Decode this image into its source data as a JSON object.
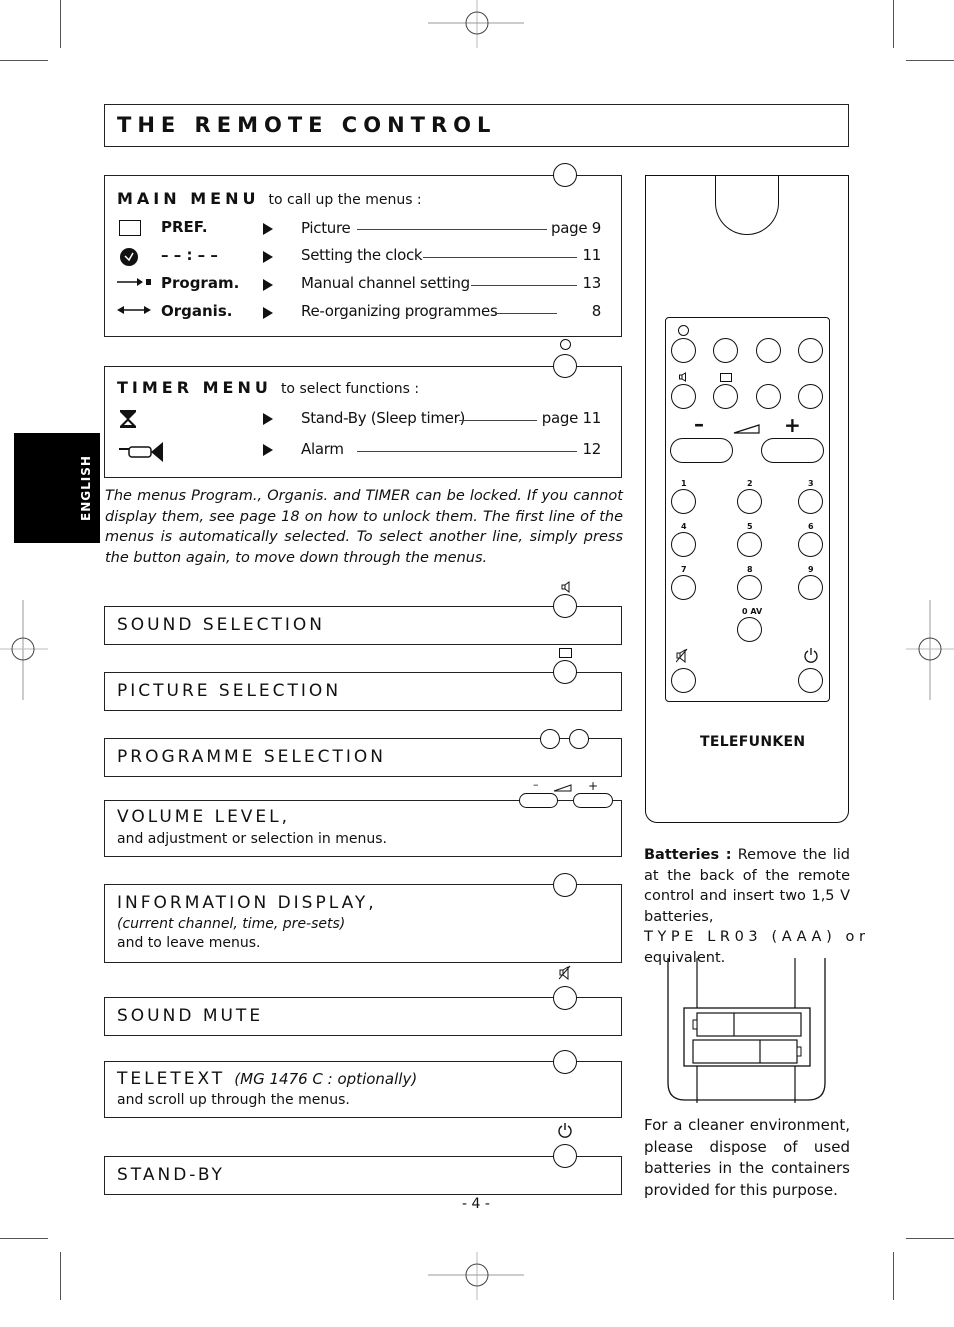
{
  "page": {
    "title": "THE REMOTE CONTROL",
    "side_tab": "ENGLISH",
    "page_number": "- 4 -"
  },
  "main_menu": {
    "title": "MAIN MENU",
    "subtitle": "to call up the menus :",
    "items": [
      {
        "icon": "screen-icon",
        "label": "PREF.",
        "desc": "Picture",
        "page": "page 9"
      },
      {
        "icon": "clock-icon",
        "label": "– – : – –",
        "desc": "Setting the clock",
        "page": "11"
      },
      {
        "icon": "arrow-right-icon",
        "label": "Program.",
        "desc": "Manual channel setting",
        "page": "13"
      },
      {
        "icon": "arrow-both-icon",
        "label": "Organis.",
        "desc": "Re-organizing programmes",
        "page": "8"
      }
    ]
  },
  "timer_menu": {
    "title": "TIMER MENU",
    "subtitle": "to select functions :",
    "items": [
      {
        "icon": "hourglass-icon",
        "desc": "Stand-By (Sleep timer)",
        "page": "page 11"
      },
      {
        "icon": "horn-icon",
        "desc": "Alarm",
        "page": "12"
      }
    ]
  },
  "note": "The menus Program., Organis. and TIMER can be locked. If you cannot display them, see page 18 on how to unlock them. The first line of the menus is automatically selected. To select another line, simply press the button again, to move down through the menus.",
  "sections": [
    {
      "title": "SOUND SELECTION"
    },
    {
      "title": "PICTURE SELECTION"
    },
    {
      "title": "PROGRAMME SELECTION"
    },
    {
      "title": "VOLUME LEVEL,",
      "line2": "and adjustment or selection in menus."
    },
    {
      "title": "INFORMATION DISPLAY,",
      "line2": "(current channel, time, pre-sets)",
      "line3": "and to leave menus."
    },
    {
      "title": "SOUND MUTE"
    },
    {
      "title": "TELETEXT",
      "title_italic": "(MG 1476 C : optionally)",
      "line2": "and scroll up through the menus."
    },
    {
      "title": "STAND-BY"
    }
  ],
  "volume_symbols": {
    "minus": "–",
    "plus": "+"
  },
  "remote": {
    "brand": "TELEFUNKEN",
    "numbers": [
      "1",
      "2",
      "3",
      "4",
      "5",
      "6",
      "7",
      "8",
      "9"
    ],
    "zero": "0 AV",
    "minus": "–",
    "plus": "+"
  },
  "batteries": {
    "heading": "Batteries :",
    "text": "Remove the lid at the back of the remote control and insert two 1,5 V batteries,",
    "type_line": "TYPE LR03 (AAA) or",
    "end": "equivalent.",
    "environment": "For a cleaner environment, please dispose of used batteries in the containers provided for this purpose."
  }
}
